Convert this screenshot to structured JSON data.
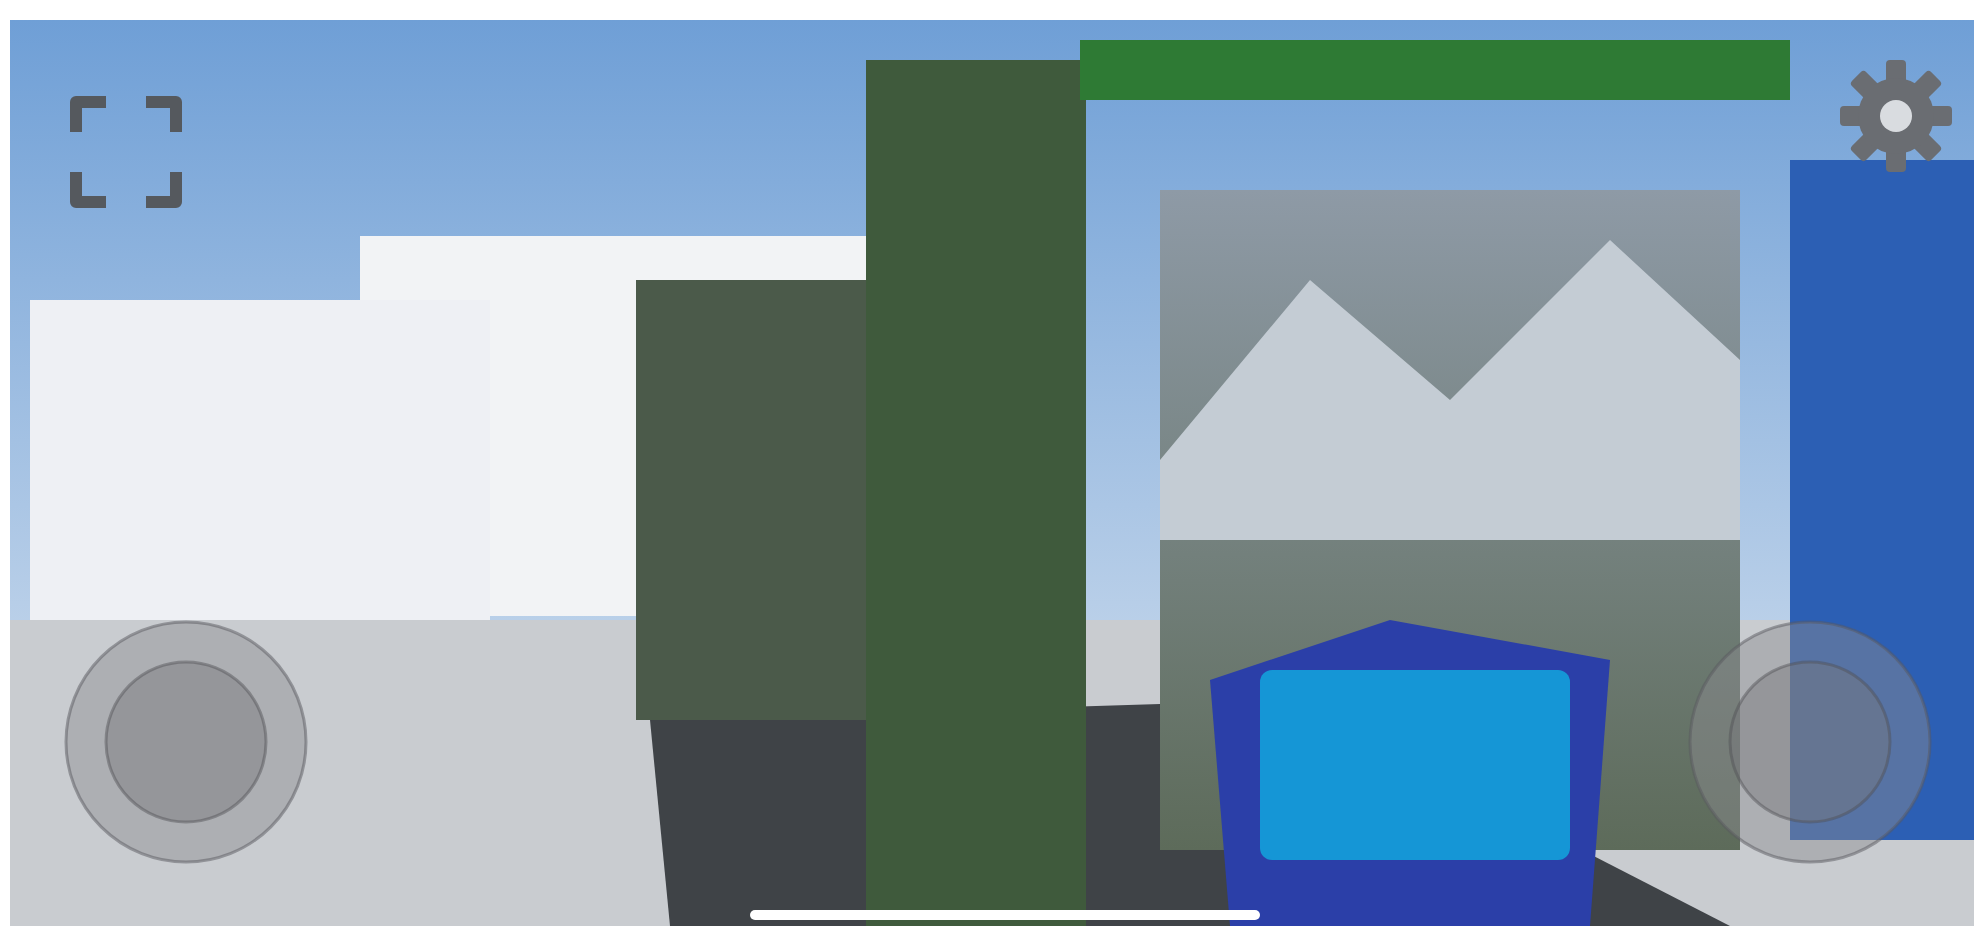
{
  "controls": [
    {
      "kind": "fullscreen"
    },
    {
      "kind": "settings"
    },
    {
      "kind": "joystick"
    },
    {
      "kind": "joystick"
    },
    {
      "kind": "home_indicator"
    }
  ]
}
